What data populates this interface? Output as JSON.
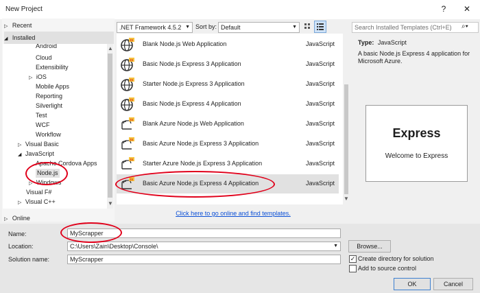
{
  "window": {
    "title": "New Project",
    "help_glyph": "?",
    "close_glyph": "✕"
  },
  "left_nav": {
    "recent": "Recent",
    "installed": "Installed",
    "online": "Online",
    "tree": [
      {
        "label": "Android",
        "indent": 2
      },
      {
        "label": "Cloud",
        "indent": 2
      },
      {
        "label": "Extensibility",
        "indent": 2
      },
      {
        "label": "iOS",
        "indent": 2
      },
      {
        "label": "Mobile Apps",
        "indent": 2
      },
      {
        "label": "Reporting",
        "indent": 2
      },
      {
        "label": "Silverlight",
        "indent": 2
      },
      {
        "label": "Test",
        "indent": 2
      },
      {
        "label": "WCF",
        "indent": 2
      },
      {
        "label": "Workflow",
        "indent": 2
      },
      {
        "label": "Visual Basic",
        "indent": 1
      },
      {
        "label": "JavaScript",
        "indent": 1
      },
      {
        "label": "Apache Cordova Apps",
        "indent": 2
      },
      {
        "label": "Node.js",
        "indent": 2
      },
      {
        "label": "Windows",
        "indent": 2
      },
      {
        "label": "Visual F#",
        "indent": 1
      },
      {
        "label": "Visual C++",
        "indent": 1
      }
    ]
  },
  "toolbar": {
    "framework": ".NET Framework 4.5.2",
    "sort_label": "Sort by:",
    "sort_value": "Default"
  },
  "templates": [
    {
      "name": "Blank Node.js Web Application",
      "lang": "JavaScript",
      "icon": "globe-icon"
    },
    {
      "name": "Basic Node.js Express 3 Application",
      "lang": "JavaScript",
      "icon": "globe-icon"
    },
    {
      "name": "Starter Node.js Express 3 Application",
      "lang": "JavaScript",
      "icon": "globe-icon"
    },
    {
      "name": "Basic Node.js Express 4 Application",
      "lang": "JavaScript",
      "icon": "globe-icon"
    },
    {
      "name": "Blank Azure Node.js Web Application",
      "lang": "JavaScript",
      "icon": "azure-cloud-icon"
    },
    {
      "name": "Basic Azure Node.js Express 3 Application",
      "lang": "JavaScript",
      "icon": "azure-cloud-icon"
    },
    {
      "name": "Starter Azure Node.js Express 3 Application",
      "lang": "JavaScript",
      "icon": "azure-cloud-icon"
    },
    {
      "name": "Basic Azure Node.js Express 4 Application",
      "lang": "JavaScript",
      "icon": "azure-cloud-icon"
    }
  ],
  "details": {
    "search_placeholder": "Search Installed Templates (Ctrl+E)",
    "type_label": "Type:",
    "type_value": "JavaScript",
    "description": "A basic Node.js Express 4 application for Microsoft Azure.",
    "preview_title": "Express",
    "preview_subtitle": "Welcome to Express"
  },
  "online_link": "Click here to go online and find templates.",
  "form": {
    "name_label": "Name:",
    "name_value": "MyScrapper",
    "location_label": "Location:",
    "location_value": "C:\\Users\\Zain\\Desktop\\Console\\",
    "solution_label": "Solution name:",
    "solution_value": "MyScrapper",
    "browse": "Browse...",
    "create_dir": "Create directory for solution",
    "add_source": "Add to source control",
    "ok": "OK",
    "cancel": "Cancel"
  },
  "colors": {
    "annotation_red": "#e0001a",
    "link_blue": "#0a4fd6",
    "selection": "#e1e1e1"
  }
}
